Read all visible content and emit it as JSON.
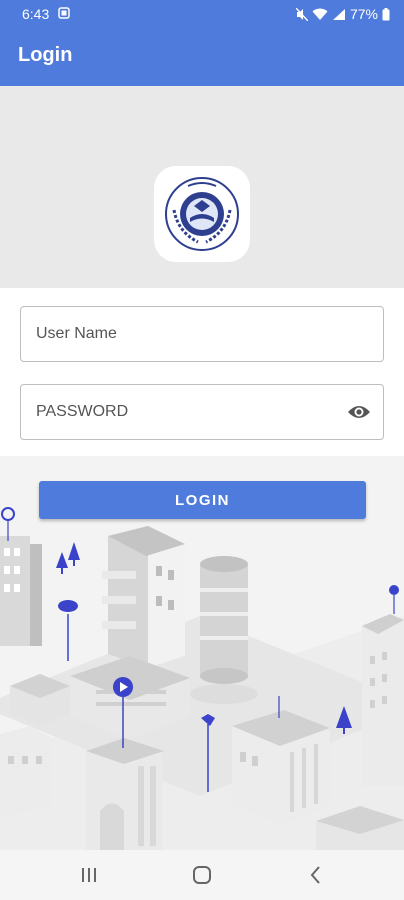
{
  "status_bar": {
    "time": "6:43",
    "battery": "77%",
    "icons": [
      "notification-icon",
      "mute-icon",
      "wifi-icon",
      "signal-icon",
      "battery-icon"
    ]
  },
  "app_bar": {
    "title": "Login"
  },
  "form": {
    "username_placeholder": "User Name",
    "password_placeholder": "PASSWORD",
    "login_label": "LOGIN"
  },
  "nav_bar": {
    "icons": [
      "recents-icon",
      "home-icon",
      "back-icon"
    ]
  },
  "colors": {
    "primary": "#4f7bdc",
    "logo_band": "#e9e9e9",
    "field_border": "#bdbdbd",
    "illustration_bg": "#f3f3f3",
    "accent_marker": "#3a43c9"
  }
}
